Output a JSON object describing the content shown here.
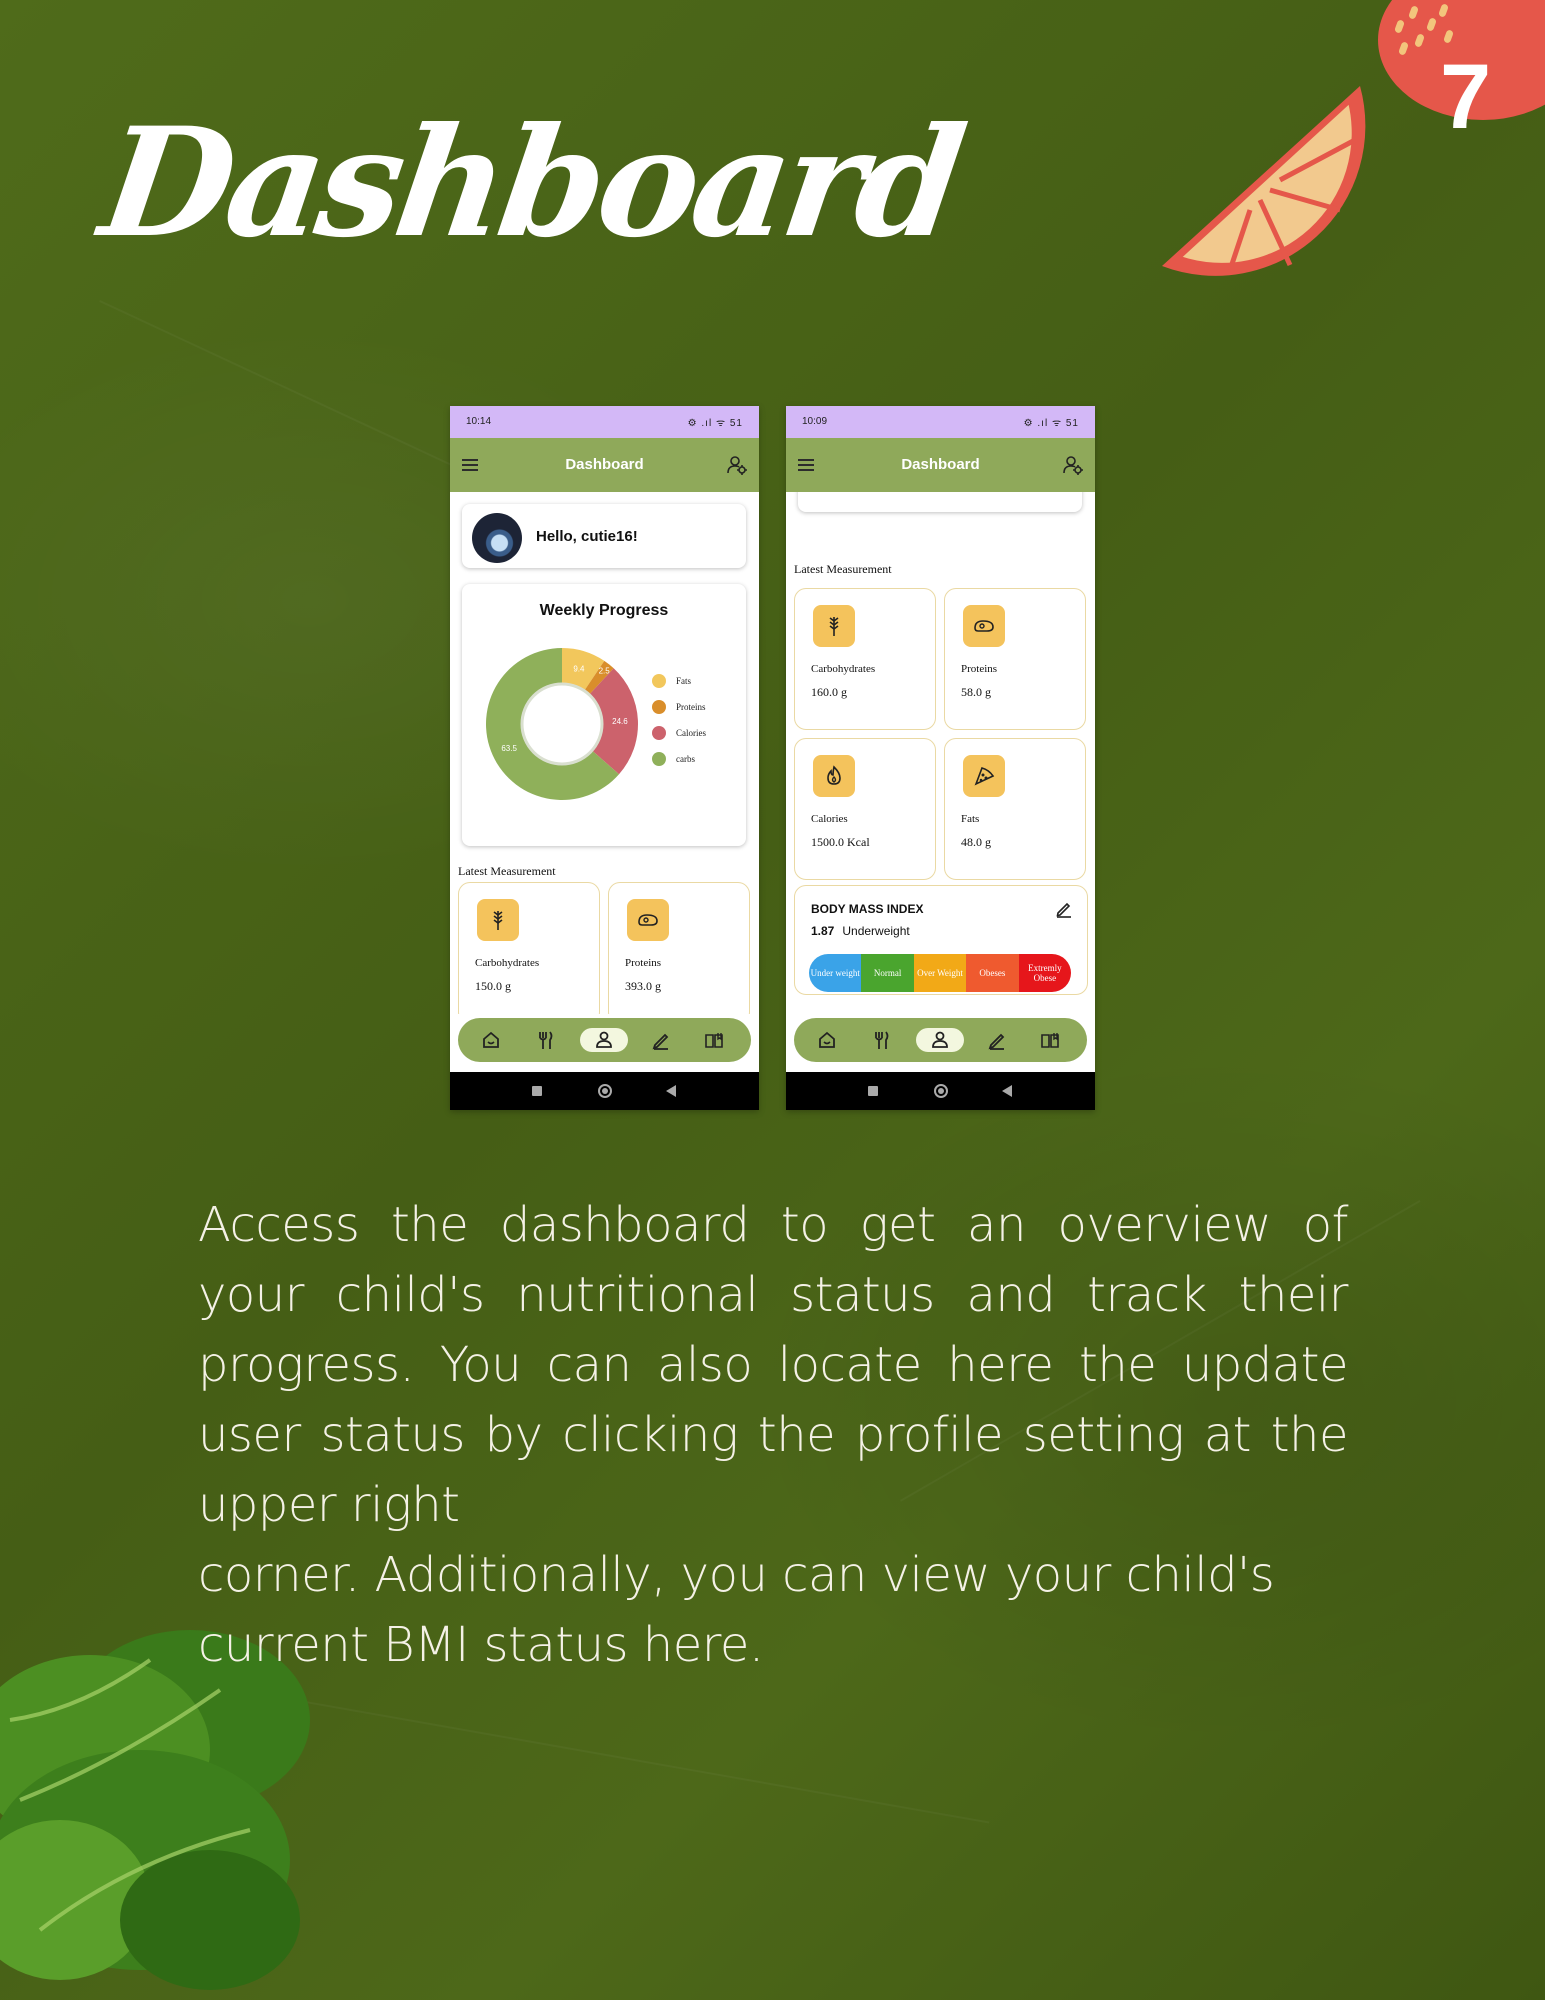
{
  "page": {
    "title": "Dashboard",
    "page_number": "7",
    "description": "Access the dashboard to get an overview of your child's nutritional status and track their progress. You can also locate here the update user status by clicking the profile setting at the upper right",
    "description_last": "corner. Additionally, you can view your child's current BMI status here."
  },
  "phone1": {
    "time": "10:14",
    "status_icons": "⚙ .ıl ᯤ 51",
    "appbar_title": "Dashboard",
    "greeting": "Hello, cutie16!",
    "progress_title": "Weekly Progress",
    "latest_title": "Latest Measurement",
    "measurements": [
      {
        "label": "Carbohydrates",
        "value": "150.0 g",
        "icon": "wheat-icon"
      },
      {
        "label": "Proteins",
        "value": "393.0 g",
        "icon": "meat-icon"
      }
    ]
  },
  "phone2": {
    "time": "10:09",
    "status_icons": "⚙ .ıl ᯤ 51",
    "appbar_title": "Dashboard",
    "latest_title": "Latest Measurement",
    "measurements": [
      {
        "label": "Carbohydrates",
        "value": "160.0 g",
        "icon": "wheat-icon"
      },
      {
        "label": "Proteins",
        "value": "58.0 g",
        "icon": "meat-icon"
      },
      {
        "label": "Calories",
        "value": "1500.0 Kcal",
        "icon": "flame-icon"
      },
      {
        "label": "Fats",
        "value": "48.0 g",
        "icon": "pizza-icon"
      }
    ],
    "bmi": {
      "title": "BODY MASS INDEX",
      "value": "1.87",
      "status": "Underweight",
      "scale": [
        {
          "label": "Under weight",
          "color": "#3aa3e8"
        },
        {
          "label": "Normal",
          "color": "#4aa52e"
        },
        {
          "label": "Over Weight",
          "color": "#f2a917"
        },
        {
          "label": "Obeses",
          "color": "#ef5a2f"
        },
        {
          "label": "Extremly Obese",
          "color": "#e6161b"
        }
      ]
    }
  },
  "chart_data": {
    "type": "pie",
    "title": "Weekly Progress",
    "categories": [
      "Fats",
      "Proteins",
      "Calories",
      "carbs"
    ],
    "values": [
      9.4,
      2.5,
      24.6,
      63.5
    ],
    "colors": [
      "#f2c75c",
      "#d98e2b",
      "#cc626c",
      "#8fb05a"
    ],
    "legend": "right"
  },
  "nav_icons": [
    "home-icon",
    "utensils-icon",
    "profile-icon",
    "edit-icon",
    "book-icon"
  ]
}
